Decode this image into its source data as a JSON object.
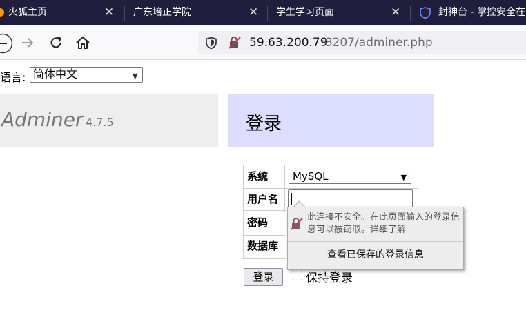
{
  "browser": {
    "tabs": [
      {
        "label": "火狐主页",
        "close": "✕"
      },
      {
        "label": "广东培正学院",
        "close": "✕"
      },
      {
        "label": "学生学习页面",
        "close": "✕"
      },
      {
        "label": "封神台 - 掌控安全在"
      }
    ],
    "url_host": "59.63.200.79",
    "url_rest": ":8207/adminer.php",
    "icons": [
      "back-icon",
      "forward-icon",
      "reload-icon",
      "home-icon",
      "shield-icon",
      "insecure-lock-icon"
    ]
  },
  "page": {
    "language_label": "语言:",
    "language_selected": "简体中文",
    "logo_name": "Adminer",
    "logo_version": "4.7.5",
    "title": "登录"
  },
  "form": {
    "system_label": "系统",
    "system_value": "MySQL",
    "username_label": "用户名",
    "password_label": "密码",
    "database_label": "数据库",
    "login_button": "登录",
    "permanent_label": "保持登录"
  },
  "popup": {
    "message": "此连接不安全。在此页面输入的登录信息可以被窃取。详细了解",
    "link": "查看已保存的登录信息"
  },
  "colors": {
    "tabbar": "#1f1e3c",
    "title_bg": "#ddddff",
    "logo_bg": "#eeeeee",
    "insecure_red": "#e22850"
  }
}
